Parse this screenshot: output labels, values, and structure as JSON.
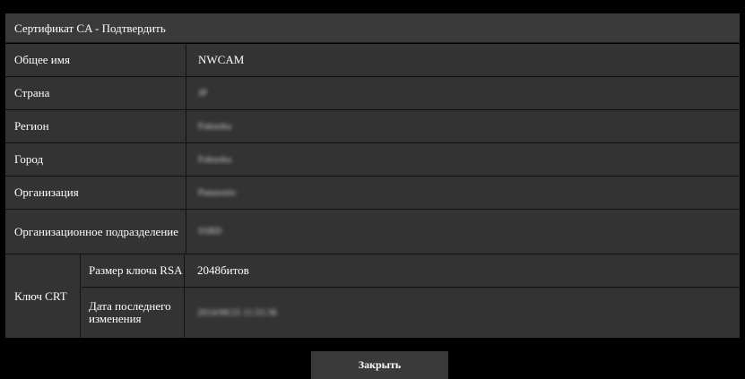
{
  "dialog": {
    "title": "Сертификат CA - Подтвердить",
    "rows": [
      {
        "label": "Общее имя",
        "value": "NWCAM",
        "blurred": false
      },
      {
        "label": "Страна",
        "value": "JP",
        "blurred": true
      },
      {
        "label": "Регион",
        "value": "Fukuoka",
        "blurred": true
      },
      {
        "label": "Город",
        "value": "Fukuoka",
        "blurred": true
      },
      {
        "label": "Организация",
        "value": "Panasonic",
        "blurred": true
      },
      {
        "label": "Организационное подразделение",
        "value": "SSBD",
        "blurred": true
      }
    ],
    "key": {
      "label": "Ключ CRT",
      "rows": [
        {
          "label": "Размер ключа RSA",
          "value": "2048битов"
        },
        {
          "label": "Дата последнего изменения",
          "value": "2014/08/25 11:55:36"
        }
      ]
    },
    "close_label": "Закрыть"
  }
}
